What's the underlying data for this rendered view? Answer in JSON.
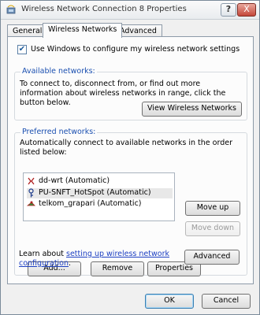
{
  "window": {
    "title": "Wireless Network Connection 8 Properties",
    "help_label": "?",
    "close_label": "X"
  },
  "tabs": [
    {
      "label": "General",
      "active": false
    },
    {
      "label": "Wireless Networks",
      "active": true
    },
    {
      "label": "Advanced",
      "active": false
    }
  ],
  "use_windows": {
    "label": "Use Windows to configure my wireless network settings",
    "checked": true,
    "check_glyph": "✔"
  },
  "available": {
    "group_label": "Available networks:",
    "description": "To connect to, disconnect from, or find out more information about wireless networks in range, click the button below.",
    "view_button": "View Wireless Networks"
  },
  "preferred": {
    "group_label": "Preferred networks:",
    "description": "Automatically connect to available networks in the order listed below:",
    "networks": [
      {
        "label": "dd-wrt (Automatic)",
        "icon": "wireless-network-icon"
      },
      {
        "label": "PU-SNFT_HotSpot (Automatic)",
        "icon": "network-key-icon"
      },
      {
        "label": "telkom_grapari (Automatic)",
        "icon": "wireless-network-icon"
      }
    ],
    "move_up": "Move up",
    "move_down": "Move down",
    "add": "Add...",
    "remove": "Remove",
    "properties": "Properties"
  },
  "learn": {
    "prefix": "Learn about ",
    "link_text_1": "setting up wireless network",
    "link_text_2": "configuration",
    "suffix": ".",
    "advanced_button": "Advanced"
  },
  "footer": {
    "ok": "OK",
    "cancel": "Cancel"
  }
}
